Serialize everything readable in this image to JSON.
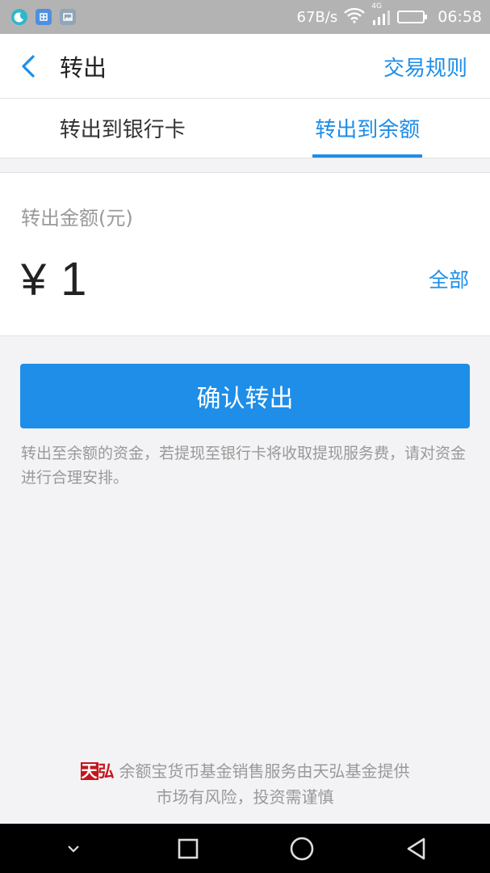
{
  "status_bar": {
    "net_speed": "67B/s",
    "network_type": "4G",
    "time": "06:58",
    "icons": [
      "moon-icon",
      "app-notification-icon",
      "gallery-icon",
      "wifi-icon",
      "signal-icon",
      "battery-icon"
    ]
  },
  "header": {
    "title": "转出",
    "rules_label": "交易规则"
  },
  "tabs": [
    {
      "label": "转出到银行卡",
      "active": false
    },
    {
      "label": "转出到余额",
      "active": true
    }
  ],
  "amount": {
    "label": "转出金额(元)",
    "currency_symbol": "¥",
    "value": "1",
    "all_label": "全部"
  },
  "confirm_label": "确认转出",
  "notice_text": "转出至余额的资金，若提现至银行卡将收取提现服务费，请对资金进行合理安排。",
  "footer": {
    "logo_text_a": "天",
    "logo_text_b": "弘",
    "line1": "余额宝货币基金销售服务由天弘基金提供",
    "line2": "市场有风险，投资需谨慎"
  },
  "colors": {
    "accent": "#1e8ee8",
    "status_bar": "#b3b3b3",
    "background": "#f3f3f5",
    "logo_red": "#c4161c"
  }
}
